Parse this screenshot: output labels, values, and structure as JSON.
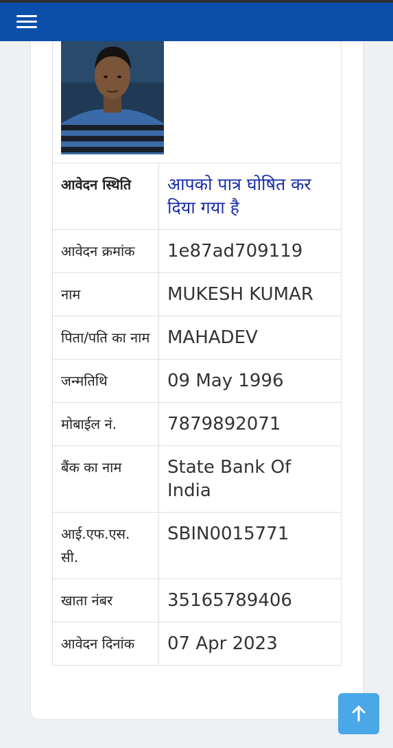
{
  "navbar": {
    "menu_icon": "hamburger-menu-icon",
    "color": "#0b4faa"
  },
  "applicant": {
    "photo": "applicant-photo",
    "rows": [
      {
        "label": "आवेदन स्थिति",
        "value": "आपको पात्र घोषित कर दिया गया है"
      },
      {
        "label": "आवेदन क्रमांक",
        "value": "1e87ad709119"
      },
      {
        "label": "नाम",
        "value": "MUKESH KUMAR"
      },
      {
        "label": "पिता/पति का नाम",
        "value": "MAHADEV"
      },
      {
        "label": "जन्मतिथि",
        "value": "09 May 1996"
      },
      {
        "label": "मोबाईल नं.",
        "value": "7879892071"
      },
      {
        "label": "बैंक का नाम",
        "value": "State Bank Of India"
      },
      {
        "label": "आई.एफ.एस. सी.",
        "value": "SBIN0015771"
      },
      {
        "label": "खाता नंबर",
        "value": "35165789406"
      },
      {
        "label": "आवेदन दिनांक",
        "value": "07 Apr 2023"
      }
    ]
  },
  "scroll_top": {
    "icon": "arrow-up-icon",
    "color": "#4aa8e8"
  }
}
